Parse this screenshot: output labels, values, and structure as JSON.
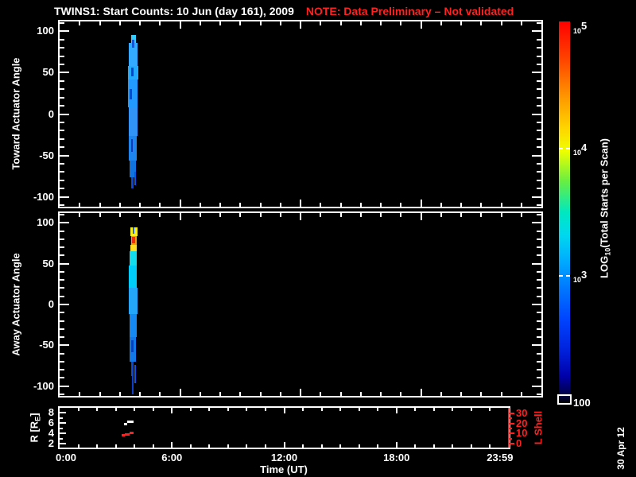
{
  "title": {
    "main": "TWINS1: Start Counts: 10 Jun (day 161), 2009",
    "note": "NOTE: Data Preliminary – Not validated"
  },
  "colors": {
    "background": "#000000",
    "foreground": "#ffffff",
    "note_red": "#ff2020",
    "lshell_red": "#ff2020"
  },
  "date_stamp": "30 Apr 12",
  "x_axis": {
    "title": "Time (UT)",
    "minor_step_hours": 1,
    "major_step_hours": 6,
    "ticks": [
      {
        "hour": 0,
        "label": "0:00"
      },
      {
        "hour": 6,
        "label": "6:00"
      },
      {
        "hour": 12,
        "label": "12:00"
      },
      {
        "hour": 18,
        "label": "18:00"
      },
      {
        "hour": 23.983,
        "label": "23:59"
      }
    ]
  },
  "colorbar": {
    "label_pre": "LOG",
    "label_sub": "10",
    "label_post": "(Total Starts per Scan)",
    "ticks": [
      {
        "frac": 0,
        "base": "10",
        "exp": "5"
      },
      {
        "frac": 0.333,
        "base": "10",
        "exp": "4"
      },
      {
        "frac": 0.667,
        "base": "10",
        "exp": "3"
      },
      {
        "frac": 1,
        "text": "100"
      }
    ],
    "gradient": [
      {
        "pos": 0,
        "c": "#ff0000"
      },
      {
        "pos": 0.1,
        "c": "#ff4400"
      },
      {
        "pos": 0.2,
        "c": "#ff9900"
      },
      {
        "pos": 0.28,
        "c": "#ffd500"
      },
      {
        "pos": 0.34,
        "c": "#eeff00"
      },
      {
        "pos": 0.42,
        "c": "#66ee44"
      },
      {
        "pos": 0.5,
        "c": "#00e8c0"
      },
      {
        "pos": 0.56,
        "c": "#00d8ee"
      },
      {
        "pos": 0.63,
        "c": "#00aaff"
      },
      {
        "pos": 0.7,
        "c": "#0077ff"
      },
      {
        "pos": 0.78,
        "c": "#0044ff"
      },
      {
        "pos": 0.86,
        "c": "#0022dd"
      },
      {
        "pos": 0.93,
        "c": "#0000aa"
      },
      {
        "pos": 0.98,
        "c": "#000044"
      },
      {
        "pos": 1,
        "c": "#000000"
      }
    ]
  },
  "chart_data": {
    "x": {
      "label": "Time (UT)",
      "lim_hours": [
        0,
        24
      ]
    },
    "charts": [
      {
        "id": "toward",
        "type": "heatmap",
        "ylabel": "Toward Actuator Angle",
        "ylim": [
          -112,
          112
        ],
        "y_ticks": [
          100,
          50,
          0,
          -50,
          -100
        ],
        "y_minor_step": 10,
        "segments": [
          {
            "t": [
              3.55,
              3.8
            ],
            "a": [
              86,
              96
            ],
            "c": "#33ccff"
          },
          {
            "t": [
              3.45,
              3.9
            ],
            "a": [
              58,
              86
            ],
            "c": "#33aaff"
          },
          {
            "t": [
              3.62,
              3.72
            ],
            "a": [
              80,
              90
            ],
            "c": "#1155dd"
          },
          {
            "t": [
              3.42,
              3.92
            ],
            "a": [
              42,
              58
            ],
            "c": "#22aaff"
          },
          {
            "t": [
              3.58,
              3.68
            ],
            "a": [
              46,
              56
            ],
            "c": "#0844cc"
          },
          {
            "t": [
              3.42,
              3.9
            ],
            "a": [
              8,
              42
            ],
            "c": "#2299ff"
          },
          {
            "t": [
              3.5,
              3.6
            ],
            "a": [
              18,
              30
            ],
            "c": "#0a4ad0"
          },
          {
            "t": [
              3.45,
              3.9
            ],
            "a": [
              -26,
              8
            ],
            "c": "#3093f5"
          },
          {
            "t": [
              3.45,
              3.85
            ],
            "a": [
              -56,
              -26
            ],
            "c": "#1f85ee"
          },
          {
            "t": [
              3.55,
              3.65
            ],
            "a": [
              -46,
              -30
            ],
            "c": "#0a3abb"
          },
          {
            "t": [
              3.5,
              3.8
            ],
            "a": [
              -76,
              -56
            ],
            "c": "#1173e0"
          },
          {
            "t": [
              3.55,
              3.67
            ],
            "a": [
              -90,
              -76
            ],
            "c": "#0a47d8"
          },
          {
            "t": [
              3.73,
              3.8
            ],
            "a": [
              -86,
              -70
            ],
            "c": "#0c55e0"
          }
        ]
      },
      {
        "id": "away",
        "type": "heatmap",
        "ylabel": "Away Actuator Angle",
        "ylim": [
          -112,
          112
        ],
        "y_ticks": [
          100,
          50,
          0,
          -50,
          -100
        ],
        "y_minor_step": 10,
        "segments": [
          {
            "t": [
              3.52,
              3.88
            ],
            "a": [
              84,
              94
            ],
            "c": "#f5ee22"
          },
          {
            "t": [
              3.64,
              3.72
            ],
            "a": [
              87,
              94
            ],
            "c": "#2266ee"
          },
          {
            "t": [
              3.55,
              3.85
            ],
            "a": [
              73,
              84
            ],
            "c": "#ff9911"
          },
          {
            "t": [
              3.6,
              3.76
            ],
            "a": [
              75,
              83
            ],
            "c": "#ee2e11"
          },
          {
            "t": [
              3.52,
              3.84
            ],
            "a": [
              65,
              73
            ],
            "c": "#ffdd22"
          },
          {
            "t": [
              3.5,
              3.84
            ],
            "a": [
              48,
              65
            ],
            "c": "#11ddee"
          },
          {
            "t": [
              3.46,
              3.86
            ],
            "a": [
              20,
              48
            ],
            "c": "#00ccfa"
          },
          {
            "t": [
              3.44,
              3.9
            ],
            "a": [
              -12,
              20
            ],
            "c": "#25a5f8"
          },
          {
            "t": [
              3.5,
              3.86
            ],
            "a": [
              -40,
              -12
            ],
            "c": "#1688f2"
          },
          {
            "t": [
              3.5,
              3.8
            ],
            "a": [
              -70,
              -40
            ],
            "c": "#1377e8"
          },
          {
            "t": [
              3.58,
              3.7
            ],
            "a": [
              -58,
              -44
            ],
            "c": "#0a3cc0"
          },
          {
            "t": [
              3.55,
              3.7
            ],
            "a": [
              -88,
              -70
            ],
            "c": "#0a48d5"
          },
          {
            "t": [
              3.62,
              3.68
            ],
            "a": [
              -110,
              -88
            ],
            "c": "#0a40cc"
          },
          {
            "t": [
              3.74,
              3.8
            ],
            "a": [
              -96,
              -74
            ],
            "c": "#0c55dd"
          }
        ]
      },
      {
        "id": "orbit",
        "type": "line",
        "ylabel_left_pre": "R [R",
        "ylabel_left_sub": "E",
        "ylabel_left_post": "]",
        "left_lim": [
          1.3,
          9
        ],
        "left_ticks": [
          8,
          6,
          4,
          2
        ],
        "left_minor_ticks": [
          3,
          5,
          7
        ],
        "ylabel_right": "L Shell",
        "right_lim": [
          -4,
          35.5
        ],
        "right_ticks": [
          30,
          20,
          10,
          0
        ],
        "right_minor_ticks": [
          5,
          15,
          25
        ],
        "series": [
          {
            "name": "R",
            "color": "#ffffff",
            "axis": "left",
            "dashes": [
              {
                "t": [
                  3.45,
                  3.62
                ],
                "v": 5.9
              },
              {
                "t": [
                  3.62,
                  3.95
                ],
                "v": 6.4
              }
            ]
          },
          {
            "name": "L Shell",
            "color": "#ff2020",
            "axis": "right",
            "dashes": [
              {
                "t": [
                  3.3,
                  3.5
                ],
                "v": 8.6
              },
              {
                "t": [
                  3.5,
                  3.72
                ],
                "v": 9.6
              },
              {
                "t": [
                  3.72,
                  3.95
                ],
                "v": 11.3
              }
            ]
          }
        ]
      }
    ]
  }
}
